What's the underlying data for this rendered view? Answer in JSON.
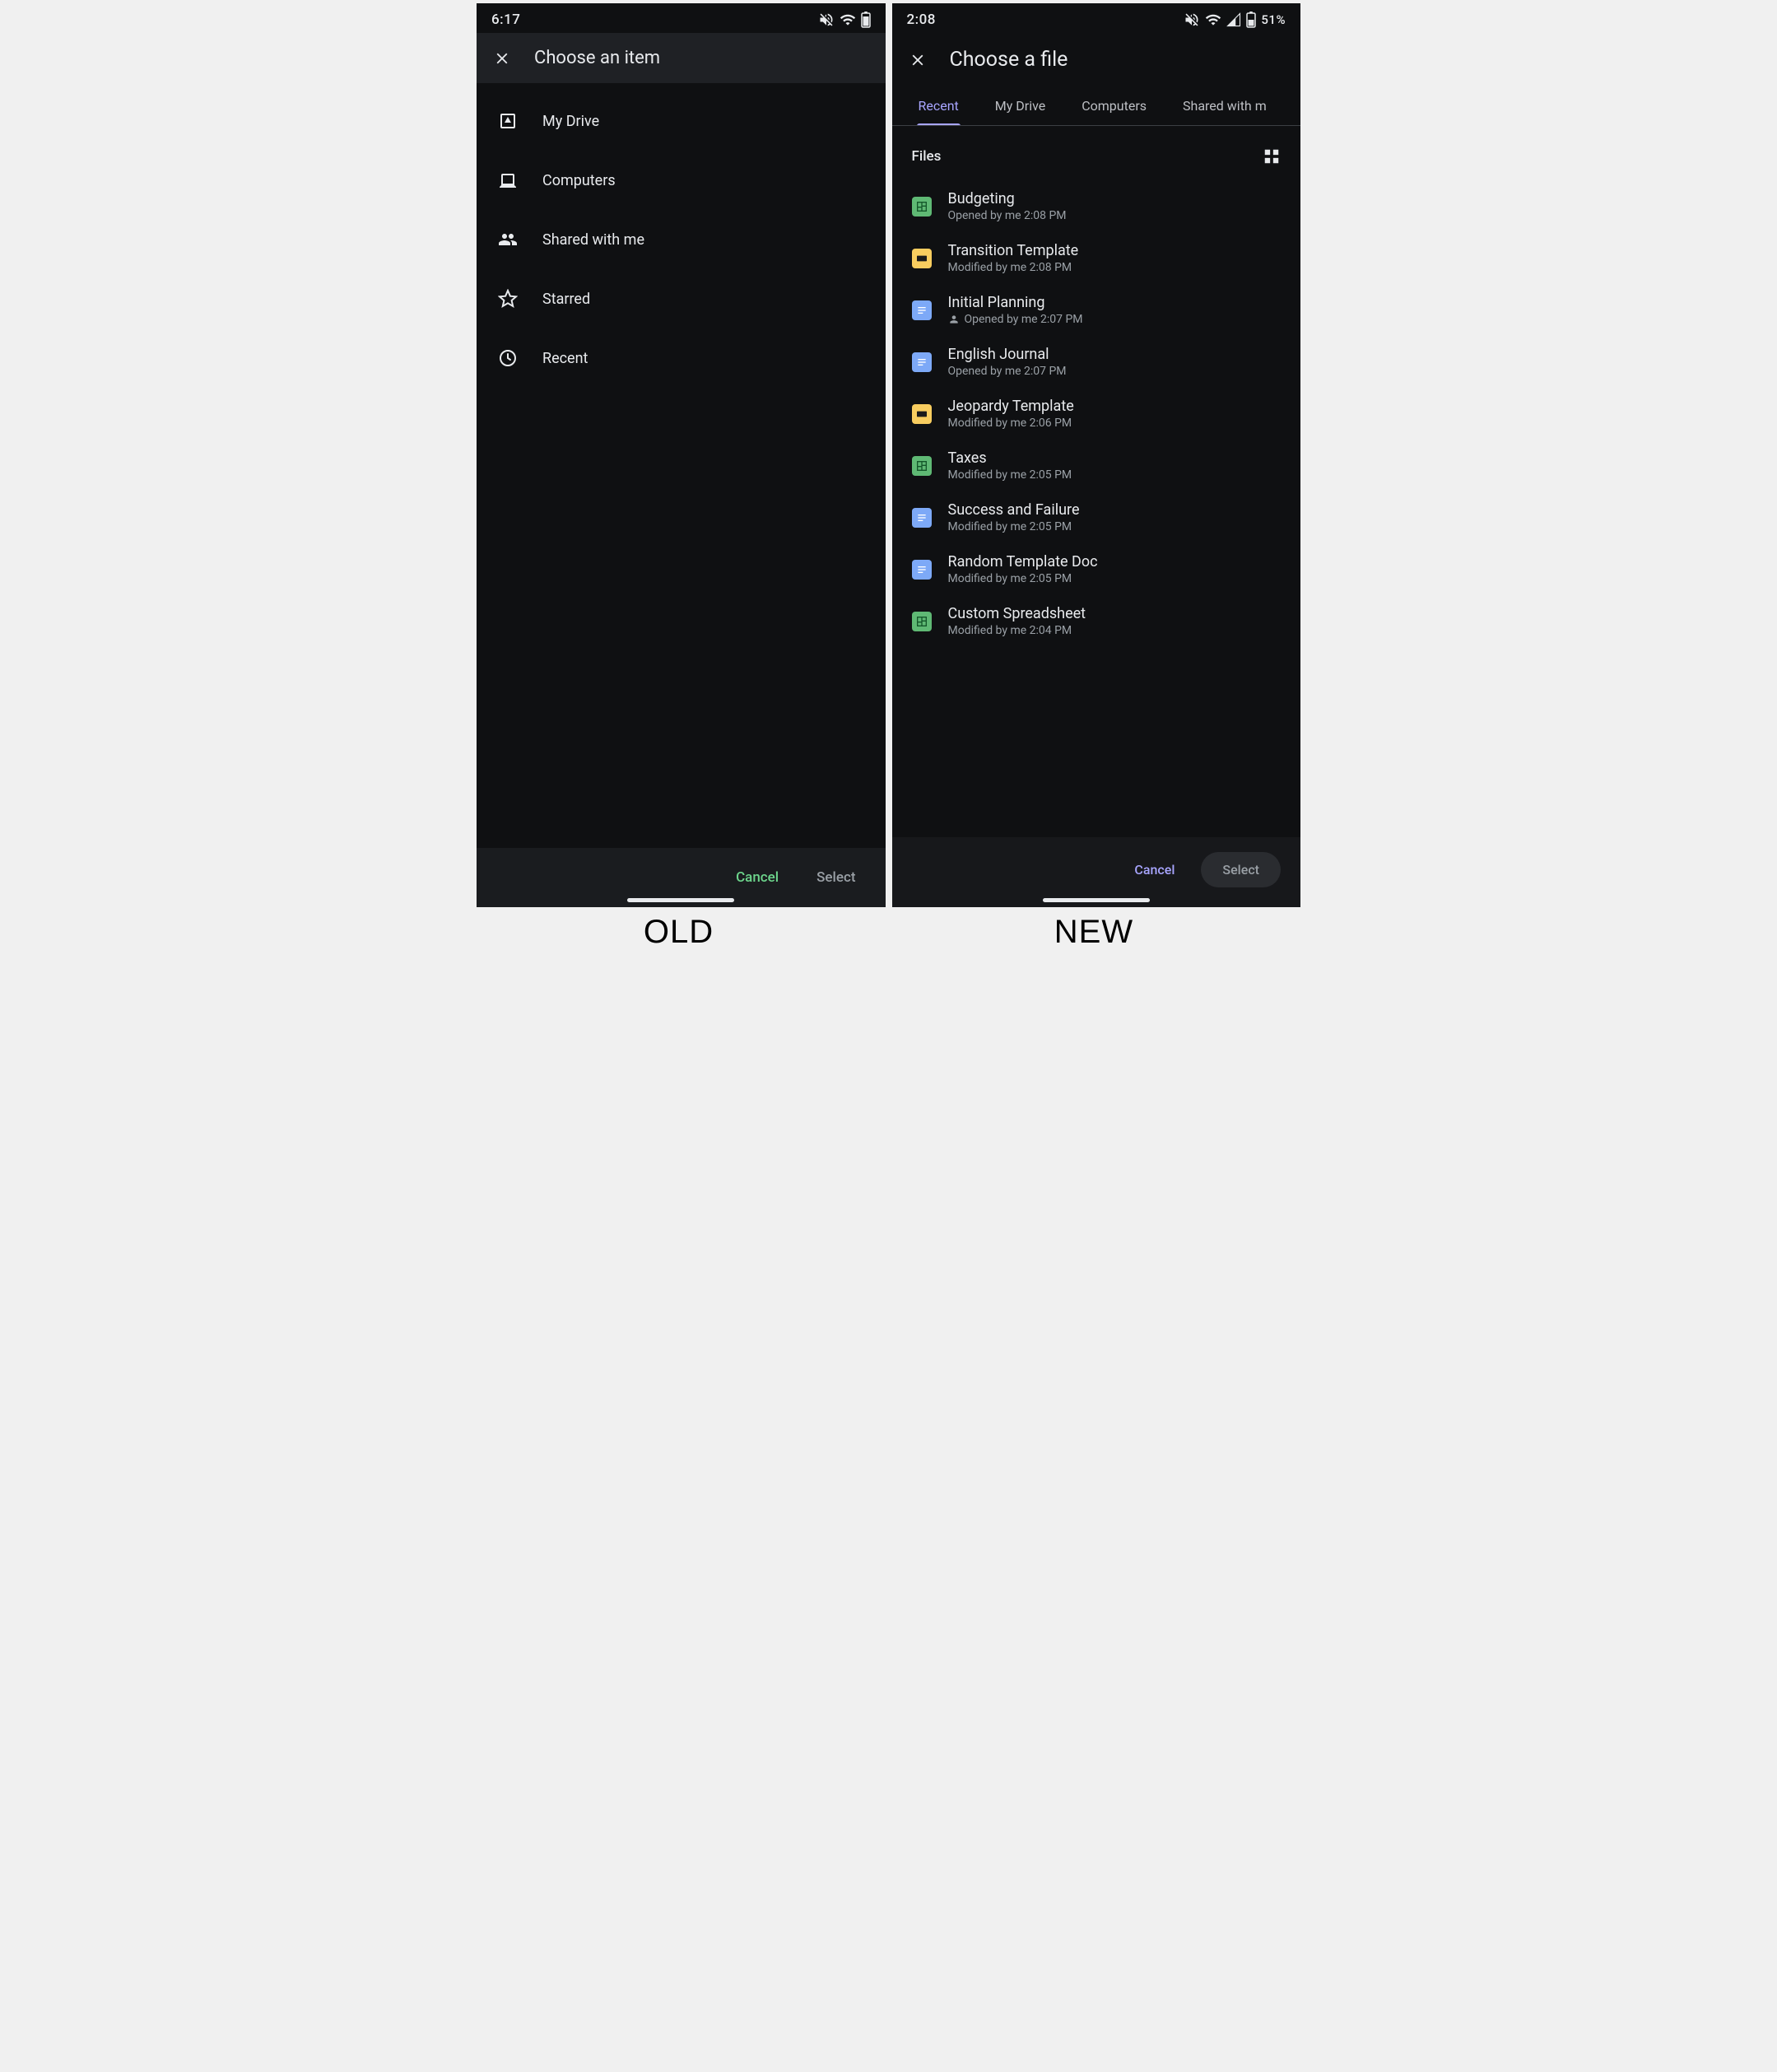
{
  "labels": {
    "old": "OLD",
    "new": "NEW"
  },
  "old": {
    "status": {
      "time": "6:17"
    },
    "header": {
      "title": "Choose an item"
    },
    "nav": [
      {
        "label": "My Drive"
      },
      {
        "label": "Computers"
      },
      {
        "label": "Shared with me"
      },
      {
        "label": "Starred"
      },
      {
        "label": "Recent"
      }
    ],
    "footer": {
      "cancel": "Cancel",
      "select": "Select"
    }
  },
  "new": {
    "status": {
      "time": "2:08",
      "battery": "51%"
    },
    "header": {
      "title": "Choose a file"
    },
    "tabs": [
      {
        "label": "Recent",
        "active": true
      },
      {
        "label": "My Drive"
      },
      {
        "label": "Computers"
      },
      {
        "label": "Shared with m"
      }
    ],
    "files_header": "Files",
    "files": [
      {
        "type": "sheet",
        "name": "Budgeting",
        "meta": "Opened by me 2:08 PM",
        "shared": false
      },
      {
        "type": "slide",
        "name": "Transition Template",
        "meta": "Modified by me 2:08 PM",
        "shared": false
      },
      {
        "type": "doc",
        "name": "Initial Planning",
        "meta": "Opened by me 2:07 PM",
        "shared": true
      },
      {
        "type": "doc",
        "name": "English Journal",
        "meta": "Opened by me 2:07 PM",
        "shared": false
      },
      {
        "type": "slide",
        "name": "Jeopardy Template",
        "meta": "Modified by me 2:06 PM",
        "shared": false
      },
      {
        "type": "sheet",
        "name": "Taxes",
        "meta": "Modified by me 2:05 PM",
        "shared": false
      },
      {
        "type": "doc",
        "name": "Success and Failure",
        "meta": "Modified by me 2:05 PM",
        "shared": false
      },
      {
        "type": "doc",
        "name": "Random Template Doc",
        "meta": "Modified by me 2:05 PM",
        "shared": false
      },
      {
        "type": "sheet",
        "name": "Custom Spreadsheet",
        "meta": "Modified by me 2:04 PM",
        "shared": false
      }
    ],
    "footer": {
      "cancel": "Cancel",
      "select": "Select"
    }
  }
}
